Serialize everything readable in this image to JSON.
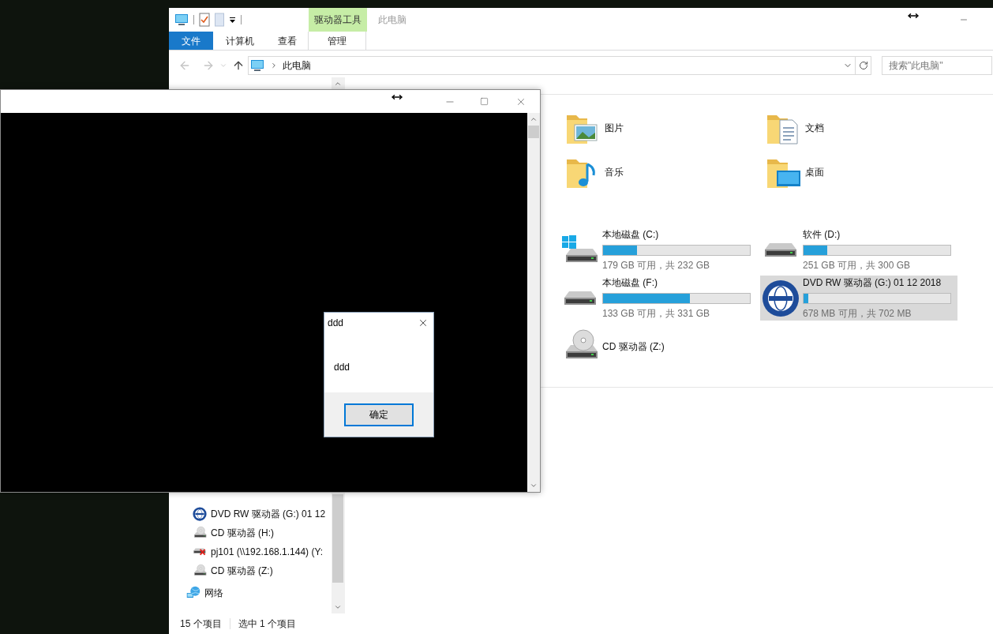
{
  "explorer": {
    "title": "此电脑",
    "contextual_tab": "驱动器工具",
    "ribbon_tabs": [
      {
        "label": "文件",
        "kind": "file"
      },
      {
        "label": "计算机",
        "kind": "tab"
      },
      {
        "label": "查看",
        "kind": "tab"
      },
      {
        "label": "管理",
        "kind": "contextual"
      }
    ],
    "address": {
      "path": "此电脑"
    },
    "search": {
      "placeholder": "搜索\"此电脑\""
    },
    "nav_items": [
      {
        "label": "DVD RW 驱动器 (G:) 01 12",
        "kind": "dvd"
      },
      {
        "label": "CD 驱动器 (H:)",
        "kind": "cd"
      },
      {
        "label": "pj101 (\\\\192.168.1.144) (Y:",
        "kind": "network-drive"
      },
      {
        "label": "CD 驱动器 (Z:)",
        "kind": "cd"
      },
      {
        "label": "网络",
        "kind": "network"
      }
    ],
    "folders": [
      {
        "label": "图片",
        "kind": "pictures"
      },
      {
        "label": "文档",
        "kind": "documents"
      },
      {
        "label": "音乐",
        "kind": "music"
      },
      {
        "label": "桌面",
        "kind": "desktop"
      }
    ],
    "drives": [
      {
        "name": "本地磁盘 (C:)",
        "kind": "windows",
        "free": "179 GB 可用，共 232 GB",
        "level": 0.23,
        "selected": false
      },
      {
        "name": "软件 (D:)",
        "kind": "disk",
        "free": "251 GB 可用，共 300 GB",
        "level": 0.16,
        "selected": false
      },
      {
        "name": "本地磁盘 (F:)",
        "kind": "disk",
        "free": "133 GB 可用，共 331 GB",
        "level": 0.59,
        "selected": false
      },
      {
        "name": "DVD RW 驱动器 (G:) 01 12 2018",
        "kind": "dvd",
        "free": "678 MB 可用，共 702 MB",
        "level": 0.03,
        "selected": true
      },
      {
        "name": "CD 驱动器 (Z:)",
        "kind": "cd",
        "selected": false
      }
    ],
    "status_bar": {
      "count": "15 个项目",
      "selection": "选中 1 个项目"
    }
  },
  "dialog": {
    "title": "ddd",
    "message": "ddd",
    "button": "确定"
  }
}
